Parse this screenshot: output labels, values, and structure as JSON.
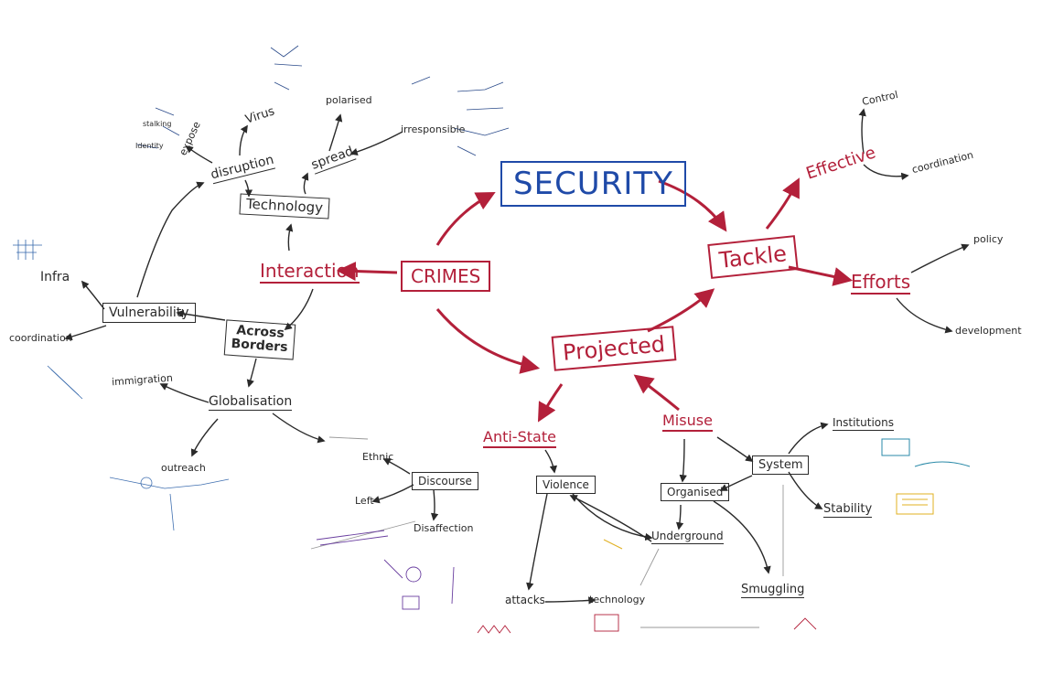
{
  "diagram": {
    "center": "CRIMES",
    "hubs": {
      "security": "SECURITY",
      "tackle": "Tackle",
      "projected": "Projected",
      "interaction": "Interaction"
    },
    "tackle_branch": {
      "effective": "Effective",
      "control": "Control",
      "coordination_r": "coordination",
      "efforts": "Efforts",
      "policy": "policy",
      "development": "development"
    },
    "left_branch": {
      "technology": "Technology",
      "disruption": "disruption",
      "spread": "spread",
      "polarised": "polarised",
      "irresponsible": "irresponsible",
      "virus": "Virus",
      "expose": "expose",
      "stalking": "stalking",
      "identity": "Identity",
      "across_borders_1": "Across",
      "across_borders_2": "Borders",
      "vulnerability": "Vulnerability",
      "infra": "Infra",
      "coordination_l": "coordination",
      "globalisation": "Globalisation",
      "immigration": "immigration",
      "outreach": "outreach"
    },
    "bottom_branch": {
      "anti_state": "Anti-State",
      "misuse": "Misuse",
      "discourse": "Discourse",
      "ethnic": "Ethnic",
      "left": "Left",
      "disaffection": "Disaffection",
      "violence": "Violence",
      "attacks": "attacks",
      "technology_b": "technology",
      "organised": "Organised",
      "underground": "Underground",
      "smuggling": "Smuggling",
      "system": "System",
      "institutions": "Institutions",
      "stability": "Stability"
    },
    "colors": {
      "red": "#b3203a",
      "blue": "#1f4aa8",
      "black": "#2a2a2a",
      "yellow": "#e0b020",
      "purple": "#6a3fa0",
      "teal": "#2a8aa8"
    }
  }
}
